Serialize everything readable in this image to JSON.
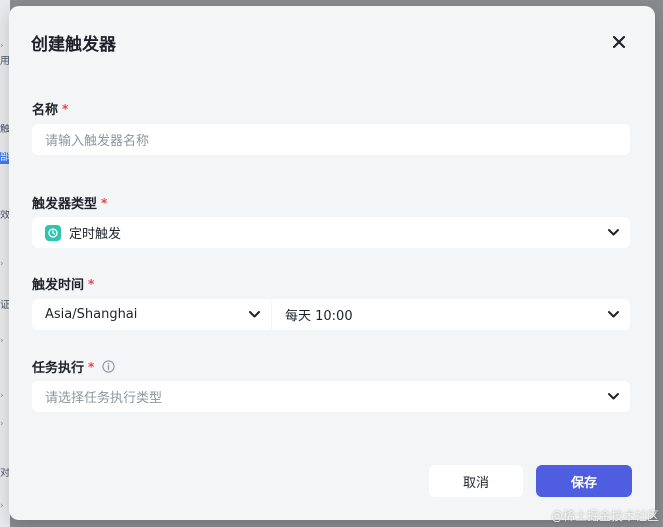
{
  "background": {
    "fragments": [
      "用",
      "触",
      "部",
      "效",
      "证",
      "对"
    ]
  },
  "dialog": {
    "title": "创建触发器",
    "close_icon": "close-icon"
  },
  "form": {
    "required_mark": "*",
    "name": {
      "label": "名称",
      "placeholder": "请输入触发器名称",
      "value": ""
    },
    "trigger_type": {
      "label": "触发器类型",
      "icon": "clock-icon",
      "value": "定时触发"
    },
    "trigger_time": {
      "label": "触发时间",
      "timezone": "Asia/Shanghai",
      "frequency": "每天 10:00"
    },
    "task": {
      "label": "任务执行",
      "info_icon": "info-icon",
      "placeholder": "请选择任务执行类型",
      "value": ""
    }
  },
  "footer": {
    "cancel_label": "取消",
    "save_label": "保存"
  },
  "watermark": "@稀土掘金技术社区",
  "colors": {
    "accent": "#4f5ee0",
    "required": "#f53f3f",
    "clock_icon_bg": "#2fc3b1"
  }
}
